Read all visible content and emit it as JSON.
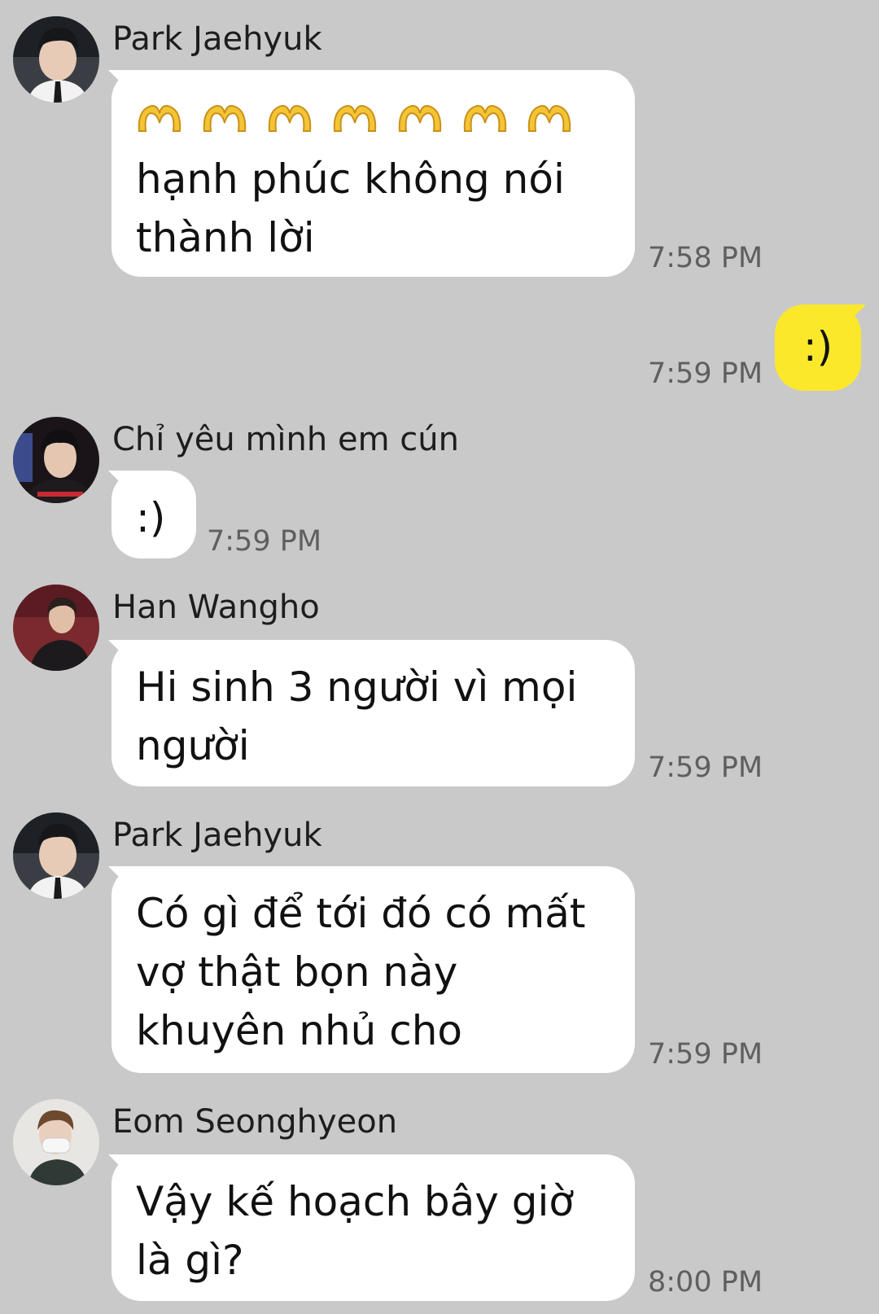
{
  "colors": {
    "background": "#c9c9c9",
    "incoming_bubble": "#ffffff",
    "outgoing_bubble": "#fce82a",
    "timestamp": "#5f5f5f"
  },
  "messages": [
    {
      "sender": "Park Jaehyuk",
      "emoji_icon": "heart-hands-icon",
      "emoji_count": 7,
      "text": "hạnh phúc không nói thành lời",
      "time": "7:58 PM"
    },
    {
      "sender": "",
      "text": ":)",
      "time": "7:59 PM",
      "outgoing": true
    },
    {
      "sender": "Chỉ yêu mình em cún",
      "text": ":)",
      "time": "7:59 PM"
    },
    {
      "sender": "Han Wangho",
      "text": "Hi sinh 3 người vì mọi người",
      "time": "7:59 PM"
    },
    {
      "sender": "Park Jaehyuk",
      "text": "Có gì để tới đó có mất vợ thật bọn này khuyên nhủ cho",
      "time": "7:59 PM"
    },
    {
      "sender": "Eom Seonghyeon",
      "text": "Vậy kế hoạch bây giờ là gì?",
      "time": "8:00 PM"
    }
  ]
}
